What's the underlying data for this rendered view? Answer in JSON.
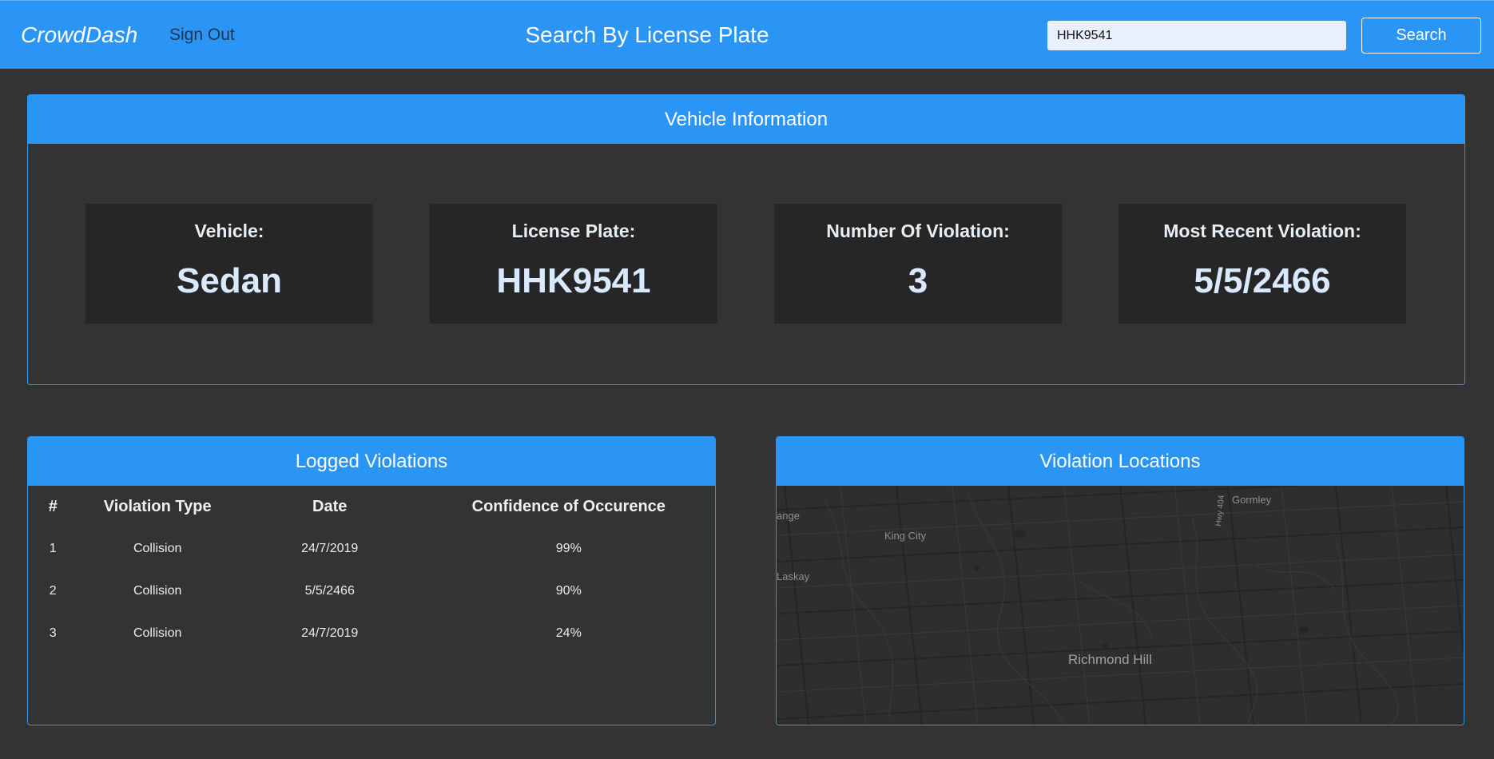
{
  "app": {
    "brand": "CrowdDash",
    "sign_out": "Sign Out",
    "page_title": "Search By License Plate"
  },
  "search": {
    "value": "HHK9541",
    "button_label": "Search"
  },
  "vehicle_panel": {
    "title": "Vehicle Information",
    "stats": [
      {
        "label": "Vehicle:",
        "value": "Sedan"
      },
      {
        "label": "License Plate:",
        "value": "HHK9541"
      },
      {
        "label": "Number Of Violation:",
        "value": "3"
      },
      {
        "label": "Most Recent Violation:",
        "value": "5/5/2466"
      }
    ]
  },
  "violations_panel": {
    "title": "Logged Violations",
    "columns": [
      "#",
      "Violation Type",
      "Date",
      "Confidence of Occurence"
    ],
    "rows": [
      [
        "1",
        "Collision",
        "24/7/2019",
        "99%"
      ],
      [
        "2",
        "Collision",
        "5/5/2466",
        "90%"
      ],
      [
        "3",
        "Collision",
        "24/7/2019",
        "24%"
      ]
    ]
  },
  "map_panel": {
    "title": "Violation Locations",
    "labels": [
      "Gormley",
      "ange",
      "King City",
      "Hwy 404",
      "Laskay",
      "Richmond Hill"
    ]
  },
  "colors": {
    "accent": "#2b95f5",
    "background": "#333333",
    "card": "#262626"
  }
}
